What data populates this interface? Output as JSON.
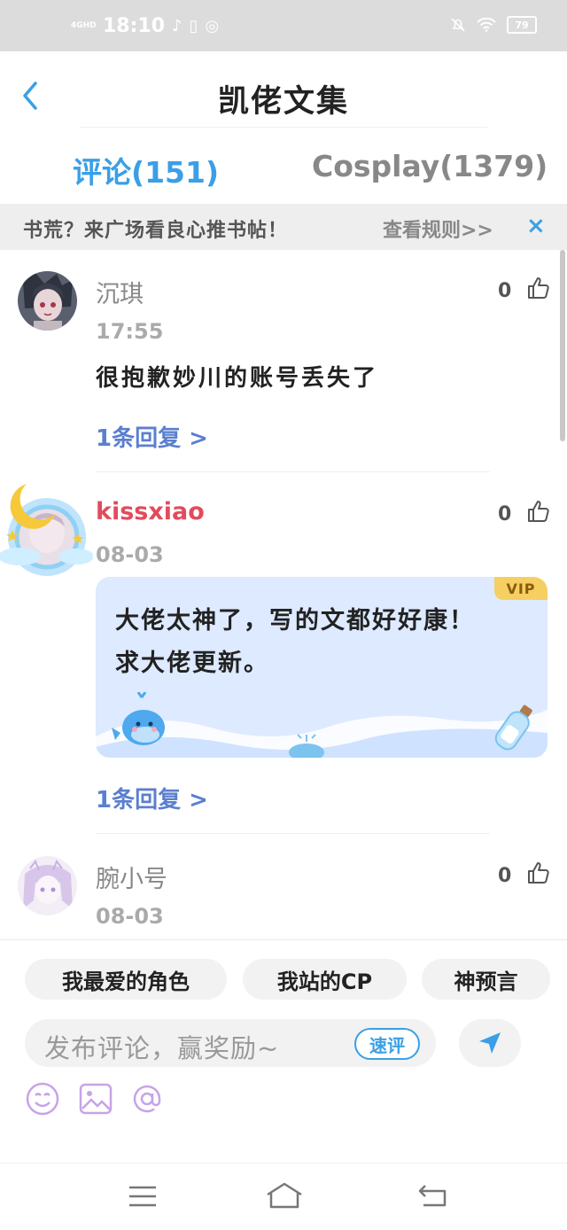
{
  "status_bar": {
    "network": "4GHD",
    "time": "18:10",
    "battery": "79"
  },
  "header": {
    "title": "凯佬文集"
  },
  "tabs": [
    {
      "label": "评论(151)",
      "active": true
    },
    {
      "label": "Cosplay(1379)",
      "active": false
    }
  ],
  "banner": {
    "text": "书荒？来广场看良心推书帖！",
    "link": "查看规则>>",
    "close": "×"
  },
  "comments": [
    {
      "username": "沉琪",
      "time": "17:55",
      "content": "很抱歉妙川的账号丢失了",
      "likes": "0",
      "reply": "1条回复 >"
    },
    {
      "username": "kissxiao",
      "time": "08-03",
      "vip_badge": "VIP",
      "content_line1": "大佬太神了，写的文都好好康！",
      "content_line2": "求大佬更新。",
      "likes": "0",
      "reply": "1条回复 >"
    },
    {
      "username": "腕小号",
      "time": "08-03",
      "likes": "0"
    }
  ],
  "composer": {
    "chips": [
      "我最爱的角色",
      "我站的CP",
      "神预言"
    ],
    "placeholder": "发布评论，赢奖励~",
    "quick_comment": "速评"
  },
  "colors": {
    "accent": "#3a9fe6",
    "vip_name": "#e24b5c",
    "reply": "#5b7fcf"
  }
}
